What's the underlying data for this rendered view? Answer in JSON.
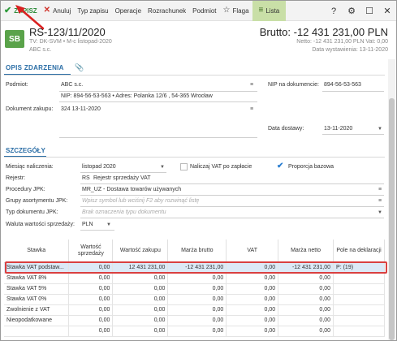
{
  "toolbar": {
    "save": "ZAPISZ",
    "cancel": "Anuluj",
    "type": "Typ zapisu",
    "operations": "Operacje",
    "settlement": "Rozrachunek",
    "entity": "Podmiot",
    "flag": "Flaga",
    "list": "Lista",
    "help_glyph": "?",
    "settings_glyph": "⚙",
    "maximize_glyph": "☐",
    "close_glyph": "✕"
  },
  "header": {
    "badge": "SB",
    "title": "RS-123/11/2020",
    "sub1": "TV: DK-SVM  •  M-c listopad-2020",
    "sub2": "ABC s.c.",
    "gross": "Brutto: -12 431 231,00 PLN",
    "net": "Netto: -12 431 231,00 PLN Vat: 0,00",
    "issued": "Data wystawienia: 13-11-2020"
  },
  "section1": {
    "title": "OPIS ZDARZENIA",
    "entity_label": "Podmiot:",
    "entity_name": "ABC s.c.",
    "entity_details": "NIP: 894-56-53-563  •  Adres: Polanka 12/6 , 54-365 Wrocław",
    "nip_label": "NIP na dokumencie:",
    "nip_value": "894-56-53-563",
    "purchase_doc_label": "Dokument zakupu:",
    "purchase_doc_value": "324 13-11-2020",
    "delivery_date_label": "Data dostawy:",
    "delivery_date_value": "13-11-2020"
  },
  "section2": {
    "title": "SZCZEGÓŁY",
    "month_label": "Miesiąc naliczenia:",
    "month_value": "listopad 2020",
    "vat_on_payment": "Naliczaj VAT po zapłacie",
    "base_proportion": "Proporcja bazowa",
    "register_label": "Rejestr:",
    "register_code": "RS",
    "register_value": "Rejestr sprzedaży VAT",
    "jpk_procedures_label": "Procedury JPK:",
    "jpk_procedures_value": "MR_UZ - Dostawa towarów używanych",
    "jpk_groups_label": "Grupy asortymentu JPK:",
    "jpk_groups_placeholder": "Wpisz symbol lub wciśnij F2 aby rozwinąć listę",
    "jpk_doc_type_label": "Typ dokumentu JPK:",
    "jpk_doc_type_placeholder": "Brak oznaczenia typu dokumentu",
    "currency_label": "Waluta wartości sprzedaży:",
    "currency_value": "PLN"
  },
  "table": {
    "headers": [
      "Stawka",
      "Wartość sprzedaży",
      "Wartość zakupu",
      "Marża brutto",
      "VAT",
      "Marża netto",
      "Pole na deklaracji"
    ],
    "rows": [
      [
        "Stawka VAT podstaw...",
        "0,00",
        "12 431 231,00",
        "-12 431 231,00",
        "0,00",
        "-12 431 231,00",
        "P: (19)"
      ],
      [
        "Stawka VAT 8%",
        "0,00",
        "0,00",
        "0,00",
        "0,00",
        "0,00",
        ""
      ],
      [
        "Stawka VAT 5%",
        "0,00",
        "0,00",
        "0,00",
        "0,00",
        "0,00",
        ""
      ],
      [
        "Stawka VAT 0%",
        "0,00",
        "0,00",
        "0,00",
        "0,00",
        "0,00",
        ""
      ],
      [
        "Zwolnienie z VAT",
        "0,00",
        "0,00",
        "0,00",
        "0,00",
        "0,00",
        ""
      ],
      [
        "Nieopodatkowane",
        "0,00",
        "0,00",
        "0,00",
        "0,00",
        "0,00",
        ""
      ],
      [
        "",
        "0,00",
        "0,00",
        "0,00",
        "0,00",
        "0,00",
        ""
      ]
    ]
  },
  "colors": {
    "accent": "#2b6ea6",
    "save": "#2e9b3a",
    "badge": "#5aa34a",
    "list_tab": "#c9dfa7",
    "highlight": "#d94040"
  }
}
